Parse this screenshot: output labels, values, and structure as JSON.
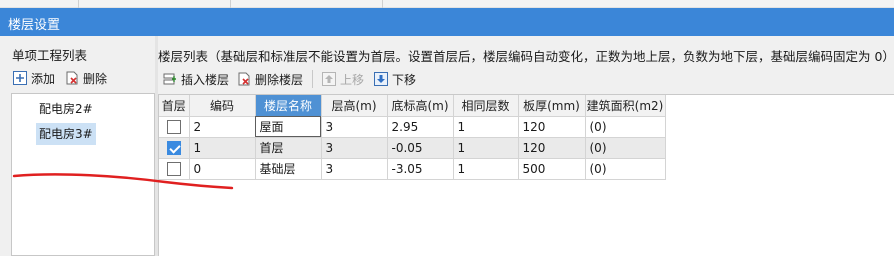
{
  "window": {
    "title": "楼层设置"
  },
  "left_panel": {
    "heading": "单项工程列表",
    "toolbar": {
      "add": "添加",
      "delete": "删除"
    },
    "items": [
      {
        "label": "配电房2#",
        "selected": false
      },
      {
        "label": "配电房3#",
        "selected": true
      }
    ]
  },
  "right_panel": {
    "heading": "楼层列表（基础层和标准层不能设置为首层。设置首层后，楼层编码自动变化，正数为地上层，负数为地下层，基础层编码固定为 0）",
    "toolbar": {
      "insert": "插入楼层",
      "delete": "删除楼层",
      "move_up": "上移",
      "move_down": "下移"
    },
    "table": {
      "columns": [
        "首层",
        "编码",
        "楼层名称",
        "层高(m)",
        "底标高(m)",
        "相同层数",
        "板厚(mm)",
        "建筑面积(m2)"
      ],
      "active_column": "楼层名称",
      "rows": [
        {
          "is_first": false,
          "code": "2",
          "name": "屋面",
          "height": "3",
          "bottom_elev": "2.95",
          "same_count": "1",
          "slab": "120",
          "area": "(0)"
        },
        {
          "is_first": true,
          "code": "1",
          "name": "首层",
          "height": "3",
          "bottom_elev": "-0.05",
          "same_count": "1",
          "slab": "120",
          "area": "(0)"
        },
        {
          "is_first": false,
          "code": "0",
          "name": "基础层",
          "height": "3",
          "bottom_elev": "-3.05",
          "same_count": "1",
          "slab": "500",
          "area": "(0)"
        }
      ]
    }
  },
  "colors": {
    "title_bar": "#3b86d8",
    "active_header": "#4f91d4",
    "selection": "#cce1f5",
    "annotation": "#e02020"
  }
}
